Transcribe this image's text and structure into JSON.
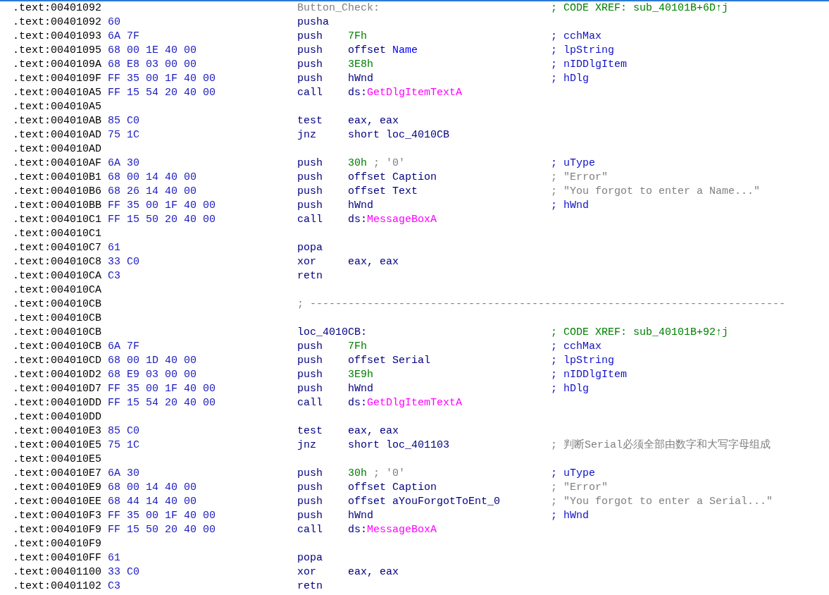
{
  "listing": [
    {
      "address": ".text:00401092",
      "label": {
        "text": "Button_Check:",
        "kind": "local"
      },
      "comment": {
        "text": "; CODE XREF: sub_40101B+6D↑j",
        "kind": "xref"
      }
    },
    {
      "address": ".text:00401092",
      "bytes": "60",
      "mnemonic": "pusha"
    },
    {
      "address": ".text:00401093",
      "bytes": "6A 7F",
      "mnemonic": "push",
      "operands": [
        {
          "text": "7Fh",
          "kind": "number"
        }
      ],
      "comment": {
        "text": "; cchMax",
        "kind": "arg"
      }
    },
    {
      "address": ".text:00401095",
      "bytes": "68 00 1E 40 00",
      "mnemonic": "push",
      "operands": [
        {
          "text": "offset ",
          "kind": "plain"
        },
        {
          "text": "Name",
          "kind": "name"
        }
      ],
      "comment": {
        "text": "; lpString",
        "kind": "arg"
      }
    },
    {
      "address": ".text:0040109A",
      "bytes": "68 E8 03 00 00",
      "mnemonic": "push",
      "operands": [
        {
          "text": "3E8h",
          "kind": "number"
        }
      ],
      "comment": {
        "text": "; nIDDlgItem",
        "kind": "arg"
      }
    },
    {
      "address": ".text:0040109F",
      "bytes": "FF 35 00 1F 40 00",
      "mnemonic": "push",
      "operands": [
        {
          "text": "hWnd",
          "kind": "plain"
        }
      ],
      "comment": {
        "text": "; hDlg",
        "kind": "arg"
      }
    },
    {
      "address": ".text:004010A5",
      "bytes": "FF 15 54 20 40 00",
      "mnemonic": "call",
      "operands": [
        {
          "text": "ds:",
          "kind": "plain"
        },
        {
          "text": "GetDlgItemTextA",
          "kind": "import"
        }
      ]
    },
    {
      "address": ".text:004010A5"
    },
    {
      "address": ".text:004010AB",
      "bytes": "85 C0",
      "mnemonic": "test",
      "operands": [
        {
          "text": "eax, eax",
          "kind": "plain"
        }
      ]
    },
    {
      "address": ".text:004010AD",
      "bytes": "75 1C",
      "mnemonic": "jnz",
      "operands": [
        {
          "text": "short loc_4010CB",
          "kind": "plain"
        }
      ]
    },
    {
      "address": ".text:004010AD"
    },
    {
      "address": ".text:004010AF",
      "bytes": "6A 30",
      "mnemonic": "push",
      "operands": [
        {
          "text": "30h",
          "kind": "number"
        },
        {
          "text": " ; '0'",
          "kind": "comment"
        }
      ],
      "comment": {
        "text": "; uType",
        "kind": "arg"
      }
    },
    {
      "address": ".text:004010B1",
      "bytes": "68 00 14 40 00",
      "mnemonic": "push",
      "operands": [
        {
          "text": "offset Caption",
          "kind": "plain"
        }
      ],
      "comment": {
        "text": "; \"Error\"",
        "kind": "string"
      }
    },
    {
      "address": ".text:004010B6",
      "bytes": "68 26 14 40 00",
      "mnemonic": "push",
      "operands": [
        {
          "text": "offset Text",
          "kind": "plain"
        }
      ],
      "comment": {
        "text": "; \"You forgot to enter a Name...\"",
        "kind": "string"
      }
    },
    {
      "address": ".text:004010BB",
      "bytes": "FF 35 00 1F 40 00",
      "mnemonic": "push",
      "operands": [
        {
          "text": "hWnd",
          "kind": "plain"
        }
      ],
      "comment": {
        "text": "; hWnd",
        "kind": "arg"
      }
    },
    {
      "address": ".text:004010C1",
      "bytes": "FF 15 50 20 40 00",
      "mnemonic": "call",
      "operands": [
        {
          "text": "ds:",
          "kind": "plain"
        },
        {
          "text": "MessageBoxA",
          "kind": "import"
        }
      ]
    },
    {
      "address": ".text:004010C1"
    },
    {
      "address": ".text:004010C7",
      "bytes": "61",
      "mnemonic": "popa"
    },
    {
      "address": ".text:004010C8",
      "bytes": "33 C0",
      "mnemonic": "xor",
      "operands": [
        {
          "text": "eax, eax",
          "kind": "plain"
        }
      ]
    },
    {
      "address": ".text:004010CA",
      "bytes": "C3",
      "mnemonic": "retn"
    },
    {
      "address": ".text:004010CA"
    },
    {
      "address": ".text:004010CB",
      "separator": "; ---------------------------------------------------------------------------"
    },
    {
      "address": ".text:004010CB"
    },
    {
      "address": ".text:004010CB",
      "label": {
        "text": "loc_4010CB:",
        "kind": "code"
      },
      "comment": {
        "text": "; CODE XREF: sub_40101B+92↑j",
        "kind": "xref"
      }
    },
    {
      "address": ".text:004010CB",
      "bytes": "6A 7F",
      "mnemonic": "push",
      "operands": [
        {
          "text": "7Fh",
          "kind": "number"
        }
      ],
      "comment": {
        "text": "; cchMax",
        "kind": "arg"
      }
    },
    {
      "address": ".text:004010CD",
      "bytes": "68 00 1D 40 00",
      "mnemonic": "push",
      "operands": [
        {
          "text": "offset Serial",
          "kind": "plain"
        }
      ],
      "comment": {
        "text": "; lpString",
        "kind": "arg"
      }
    },
    {
      "address": ".text:004010D2",
      "bytes": "68 E9 03 00 00",
      "mnemonic": "push",
      "operands": [
        {
          "text": "3E9h",
          "kind": "number"
        }
      ],
      "comment": {
        "text": "; nIDDlgItem",
        "kind": "arg"
      }
    },
    {
      "address": ".text:004010D7",
      "bytes": "FF 35 00 1F 40 00",
      "mnemonic": "push",
      "operands": [
        {
          "text": "hWnd",
          "kind": "plain"
        }
      ],
      "comment": {
        "text": "; hDlg",
        "kind": "arg"
      }
    },
    {
      "address": ".text:004010DD",
      "bytes": "FF 15 54 20 40 00",
      "mnemonic": "call",
      "operands": [
        {
          "text": "ds:",
          "kind": "plain"
        },
        {
          "text": "GetDlgItemTextA",
          "kind": "import"
        }
      ]
    },
    {
      "address": ".text:004010DD"
    },
    {
      "address": ".text:004010E3",
      "bytes": "85 C0",
      "mnemonic": "test",
      "operands": [
        {
          "text": "eax, eax",
          "kind": "plain"
        }
      ]
    },
    {
      "address": ".text:004010E5",
      "bytes": "75 1C",
      "mnemonic": "jnz",
      "operands": [
        {
          "text": "short loc_401103",
          "kind": "plain"
        }
      ],
      "comment": {
        "text": "; 判断Serial必须全部由数字和大写字母组成",
        "kind": "note"
      }
    },
    {
      "address": ".text:004010E5"
    },
    {
      "address": ".text:004010E7",
      "bytes": "6A 30",
      "mnemonic": "push",
      "operands": [
        {
          "text": "30h",
          "kind": "number"
        },
        {
          "text": " ; '0'",
          "kind": "comment"
        }
      ],
      "comment": {
        "text": "; uType",
        "kind": "arg"
      }
    },
    {
      "address": ".text:004010E9",
      "bytes": "68 00 14 40 00",
      "mnemonic": "push",
      "operands": [
        {
          "text": "offset Caption",
          "kind": "plain"
        }
      ],
      "comment": {
        "text": "; \"Error\"",
        "kind": "string"
      }
    },
    {
      "address": ".text:004010EE",
      "bytes": "68 44 14 40 00",
      "mnemonic": "push",
      "operands": [
        {
          "text": "offset aYouForgotToEnt_0",
          "kind": "plain"
        }
      ],
      "comment": {
        "text": "; \"You forgot to enter a Serial...\"",
        "kind": "string"
      }
    },
    {
      "address": ".text:004010F3",
      "bytes": "FF 35 00 1F 40 00",
      "mnemonic": "push",
      "operands": [
        {
          "text": "hWnd",
          "kind": "plain"
        }
      ],
      "comment": {
        "text": "; hWnd",
        "kind": "arg"
      }
    },
    {
      "address": ".text:004010F9",
      "bytes": "FF 15 50 20 40 00",
      "mnemonic": "call",
      "operands": [
        {
          "text": "ds:",
          "kind": "plain"
        },
        {
          "text": "MessageBoxA",
          "kind": "import"
        }
      ]
    },
    {
      "address": ".text:004010F9"
    },
    {
      "address": ".text:004010FF",
      "bytes": "61",
      "mnemonic": "popa"
    },
    {
      "address": ".text:00401100",
      "bytes": "33 C0",
      "mnemonic": "xor",
      "operands": [
        {
          "text": "eax, eax",
          "kind": "plain"
        }
      ]
    },
    {
      "address": ".text:00401102",
      "bytes": "C3",
      "mnemonic": "retn"
    }
  ]
}
